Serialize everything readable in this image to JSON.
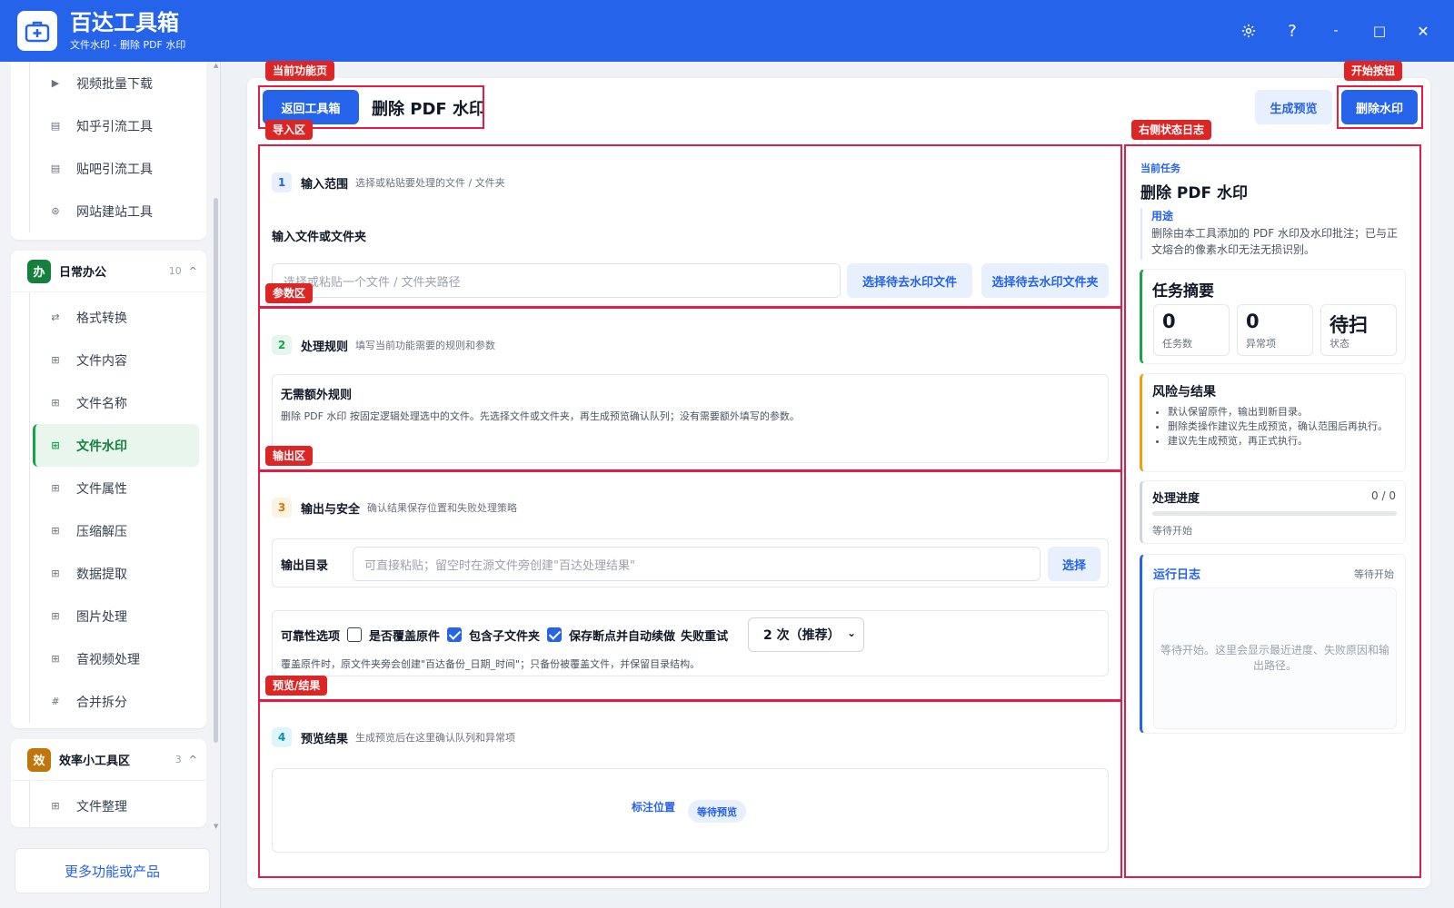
{
  "app": {
    "title": "百达工具箱",
    "subtitle": "文件水印 - 删除 PDF 水印",
    "settings_icon": "gear-icon",
    "help_label": "?",
    "minimize_label": "-",
    "maximize_label": "□",
    "close_label": "✕"
  },
  "sidebar": {
    "prev_items": [
      {
        "label": "视频批量下载",
        "icon": "video-icon"
      },
      {
        "label": "知乎引流工具",
        "icon": "doc-icon"
      },
      {
        "label": "贴吧引流工具",
        "icon": "doc-icon"
      },
      {
        "label": "网站建站工具",
        "icon": "globe-icon"
      }
    ],
    "groups": [
      {
        "badge": "办",
        "badge_color": "#15803d",
        "title": "日常办公",
        "count": "10",
        "caret": "^",
        "items": [
          {
            "label": "格式转换",
            "icon": "⇄"
          },
          {
            "label": "文件内容",
            "icon": "⊞"
          },
          {
            "label": "文件名称",
            "icon": "⊞"
          },
          {
            "label": "文件水印",
            "icon": "⊞",
            "active": true
          },
          {
            "label": "文件属性",
            "icon": "⊞"
          },
          {
            "label": "压缩解压",
            "icon": "⊞"
          },
          {
            "label": "数据提取",
            "icon": "⊞"
          },
          {
            "label": "图片处理",
            "icon": "⊞"
          },
          {
            "label": "音视频处理",
            "icon": "⊞"
          },
          {
            "label": "合并拆分",
            "icon": "#"
          }
        ]
      },
      {
        "badge": "效",
        "badge_color": "#c2750a",
        "title": "效率小工具区",
        "count": "3",
        "caret": "^",
        "items": [
          {
            "label": "文件整理",
            "icon": "⊞"
          }
        ]
      }
    ],
    "more_label": "更多功能或产品"
  },
  "annotations": {
    "current_page": "当前功能页",
    "start_button": "开始按钮",
    "import": "导入区",
    "right_log": "右侧状态日志",
    "params": "参数区",
    "output": "输出区",
    "preview": "预览/结果"
  },
  "header": {
    "back_label": "返回工具箱",
    "title": "删除 PDF 水印",
    "preview_label": "生成预览",
    "start_label": "删除水印"
  },
  "step1": {
    "num": "1",
    "title": "输入范围",
    "desc": "选择或粘贴要处理的文件 / 文件夹",
    "field_label": "输入文件或文件夹",
    "placeholder": "选择或粘贴一个文件 / 文件夹路径",
    "select_file": "选择待去水印文件",
    "select_folder": "选择待去水印文件夹"
  },
  "step2": {
    "num": "2",
    "title": "处理规则",
    "desc": "填写当前功能需要的规则和参数",
    "card_title": "无需额外规则",
    "card_text": "删除 PDF 水印 按固定逻辑处理选中的文件。先选择文件或文件夹，再生成预览确认队列；没有需要额外填写的参数。"
  },
  "step3": {
    "num": "3",
    "title": "输出与安全",
    "desc": "确认结果保存位置和失败处理策略",
    "out_label": "输出目录",
    "out_placeholder": "可直接粘贴；留空时在源文件旁创建\"百达处理结果\"",
    "choose_label": "选择",
    "reliability_label": "可靠性选项",
    "opt_overwrite": "是否覆盖原件",
    "opt_overwrite_checked": false,
    "opt_subfolders": "包含子文件夹",
    "opt_subfolders_checked": true,
    "opt_resume": "保存断点并自动续做",
    "opt_resume_checked": true,
    "retry_label": "失败重试",
    "retry_value": "2 次（推荐）",
    "note": "覆盖原件时，原文件夹旁会创建\"百达备份_日期_时间\"；只备份被覆盖文件，并保留目录结构。"
  },
  "step4": {
    "num": "4",
    "title": "预览结果",
    "desc": "生成预览后在这里确认队列和异常项",
    "mark_label": "标注位置",
    "status_badge": "等待预览"
  },
  "right": {
    "current_task_label": "当前任务",
    "task_title": "删除 PDF 水印",
    "usage_label": "用途",
    "usage_text": "删除由本工具添加的 PDF 水印及水印批注；已与正文熔合的像素水印无法无损识别。",
    "summary_title": "任务摘要",
    "stats": [
      {
        "value": "0",
        "label": "任务数"
      },
      {
        "value": "0",
        "label": "异常项"
      },
      {
        "value": "待扫",
        "label": "状态"
      }
    ],
    "risk_title": "风险与结果",
    "risk_items": [
      "默认保留原件，输出到新目录。",
      "删除类操作建议先生成预览，确认范围后再执行。",
      "建议先生成预览，再正式执行。"
    ],
    "progress_title": "处理进度",
    "progress_count": "0 / 0",
    "progress_value": 0,
    "progress_status": "等待开始",
    "log_title": "运行日志",
    "log_status": "等待开始",
    "log_placeholder": "等待开始。这里会显示最近进度、失败原因和输出路径。"
  },
  "colors": {
    "primary": "#2563eb",
    "annotation_red": "#dc2626",
    "success_green": "#16a34a",
    "warning_orange": "#f59e0b"
  }
}
